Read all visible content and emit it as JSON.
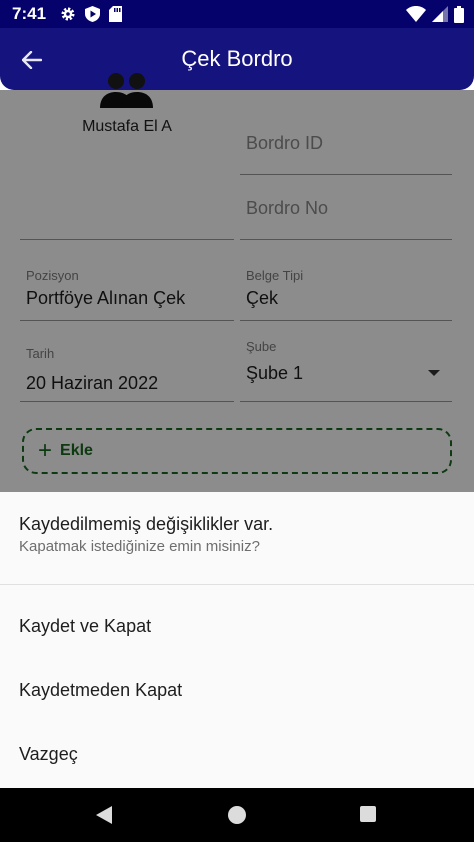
{
  "status_bar": {
    "time": "7:41"
  },
  "app_bar": {
    "title": "Çek Bordro",
    "back_icon": "arrow-left-icon"
  },
  "form": {
    "profile": {
      "icon": "people-icon",
      "name": "Mustafa El A"
    },
    "bordro_id": {
      "placeholder": "Bordro ID"
    },
    "bordro_no": {
      "placeholder": "Bordro No"
    },
    "pozisyon": {
      "label": "Pozisyon",
      "value": "Portföye Alınan Çek"
    },
    "belge_tipi": {
      "label": "Belge Tipi",
      "value": "Çek"
    },
    "tarih": {
      "label": "Tarih",
      "value": "20 Haziran 2022"
    },
    "sube": {
      "label": "Şube",
      "value": "Şube 1"
    },
    "add_button": {
      "label": "Ekle"
    }
  },
  "sheet": {
    "title": "Kaydedilmemiş değişiklikler var.",
    "subtitle": "Kapatmak istediğinize emin misiniz?",
    "items": [
      {
        "label": "Kaydet ve Kapat"
      },
      {
        "label": "Kaydetmeden Kapat"
      },
      {
        "label": "Vazgeç"
      }
    ]
  },
  "colors": {
    "status_bar": "#05036b",
    "app_bar": "#15137e",
    "accent_green": "#1b6b22"
  }
}
